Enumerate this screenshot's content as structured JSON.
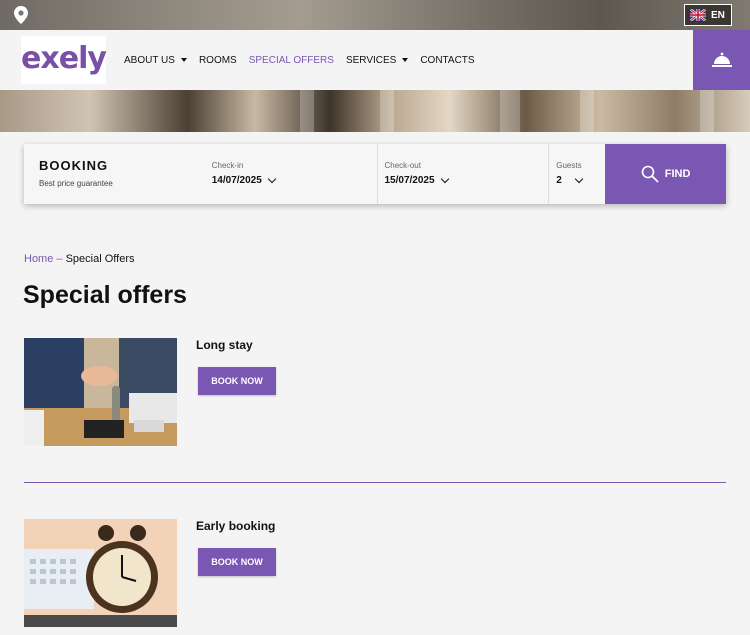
{
  "topbar": {
    "language": "EN"
  },
  "header": {
    "logo": "exely",
    "nav": [
      {
        "label": "ABOUT US",
        "dropdown": true,
        "active": false
      },
      {
        "label": "ROOMS",
        "dropdown": false,
        "active": false
      },
      {
        "label": "SPECIAL OFFERS",
        "dropdown": false,
        "active": true
      },
      {
        "label": "SERVICES",
        "dropdown": true,
        "active": false
      },
      {
        "label": "CONTACTS",
        "dropdown": false,
        "active": false
      }
    ]
  },
  "booking": {
    "title": "BOOKING",
    "subtitle": "Best price guarantee",
    "checkin_label": "Check-in",
    "checkin_value": "14/07/2025",
    "checkout_label": "Check-out",
    "checkout_value": "15/07/2025",
    "guests_label": "Guests",
    "guests_value": "2",
    "find_label": "FIND"
  },
  "breadcrumb": {
    "home": "Home",
    "separator": "–",
    "current": "Special Offers"
  },
  "page_title": "Special offers",
  "offers": [
    {
      "title": "Long stay",
      "button": "BOOK NOW"
    },
    {
      "title": "Early booking",
      "button": "BOOK NOW"
    }
  ],
  "colors": {
    "accent": "#7a57b3",
    "background": "#f4f4f4"
  }
}
